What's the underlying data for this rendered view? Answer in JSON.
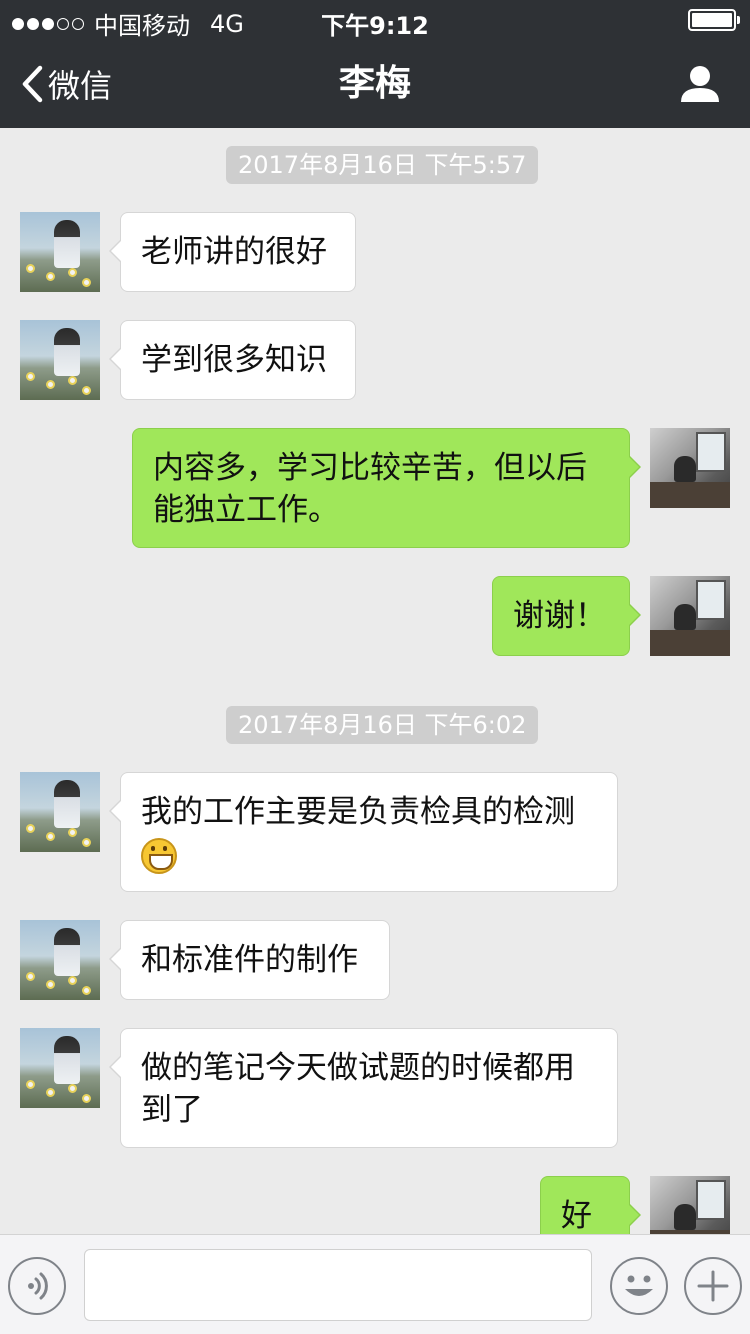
{
  "status": {
    "carrier": "中国移动",
    "network": "4G",
    "time": "下午9:12",
    "signal_filled": 3,
    "signal_total": 5
  },
  "nav": {
    "back_label": "微信",
    "title": "李梅",
    "back_icon": "chevron-left-icon",
    "profile_icon": "person-icon"
  },
  "messages": {
    "time1": "2017年8月16日 下午5:57",
    "m1": "老师讲的很好",
    "m2": "学到很多知识",
    "m3": "内容多，学习比较辛苦，但以后能独立工作。",
    "m4": "谢谢！",
    "time2": "2017年8月16日 下午6:02",
    "m5": "我的工作主要是负责检具的检测",
    "m5_emoji": "grin-emoji",
    "m6": "和标准件的制作",
    "m7": "做的笔记今天做试题的时候都用到了",
    "m8": "好"
  },
  "input": {
    "voice_icon": "voice-icon",
    "emoji_icon": "smiley-icon",
    "plus_icon": "plus-icon",
    "value": ""
  },
  "colors": {
    "nav_bg": "#2e3135",
    "chat_bg": "#ebebeb",
    "my_bubble": "#a0e75a",
    "their_bubble": "#ffffff"
  }
}
